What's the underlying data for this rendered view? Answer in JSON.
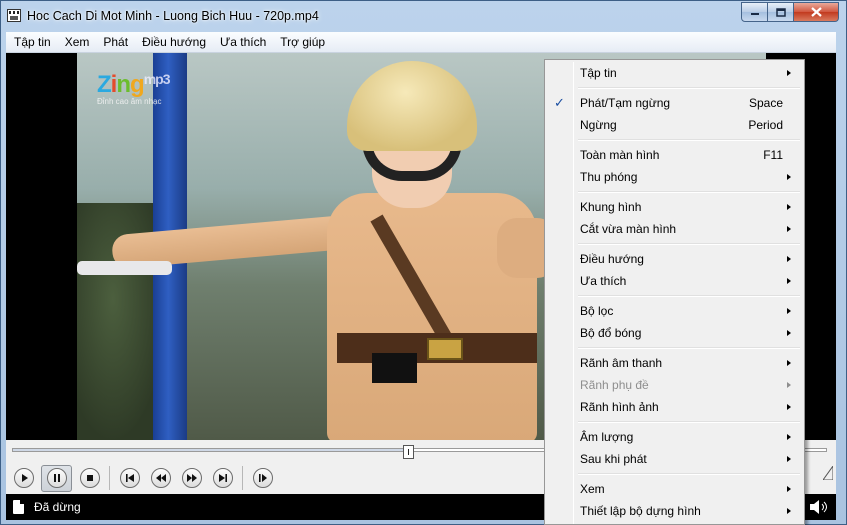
{
  "window": {
    "title": "Hoc Cach Di Mot Minh - Luong Bich Huu - 720p.mp4"
  },
  "menubar": {
    "items": [
      {
        "label": "Tập tin"
      },
      {
        "label": "Xem"
      },
      {
        "label": "Phát"
      },
      {
        "label": "Điều hướng"
      },
      {
        "label": "Ưa thích"
      },
      {
        "label": "Trợ giúp"
      }
    ]
  },
  "video": {
    "logo_main": "Zing",
    "logo_sub": "mp3",
    "logo_tagline": "Đỉnh cao âm nhạc"
  },
  "playback": {
    "position_fraction": 0.49
  },
  "status": {
    "text": "Đã dừng"
  },
  "context_menu": {
    "items": [
      {
        "label": "Tập tin",
        "submenu": true
      },
      {
        "separator": true
      },
      {
        "label": "Phát/Tạm ngừng",
        "shortcut": "Space",
        "checked": true
      },
      {
        "label": "Ngừng",
        "shortcut": "Period"
      },
      {
        "separator": true
      },
      {
        "label": "Toàn màn hình",
        "shortcut": "F11"
      },
      {
        "label": "Thu phóng",
        "submenu": true
      },
      {
        "separator": true
      },
      {
        "label": "Khung hình",
        "submenu": true
      },
      {
        "label": "Cắt vừa màn hình",
        "submenu": true
      },
      {
        "separator": true
      },
      {
        "label": "Điều hướng",
        "submenu": true
      },
      {
        "label": "Ưa thích",
        "submenu": true
      },
      {
        "separator": true
      },
      {
        "label": "Bộ lọc",
        "submenu": true
      },
      {
        "label": "Bộ đổ bóng",
        "submenu": true
      },
      {
        "separator": true
      },
      {
        "label": "Rãnh âm thanh",
        "submenu": true
      },
      {
        "label": "Rãnh phụ đề",
        "submenu": true,
        "disabled": true
      },
      {
        "label": "Rãnh hình ảnh",
        "submenu": true
      },
      {
        "separator": true
      },
      {
        "label": "Âm lượng",
        "submenu": true
      },
      {
        "label": "Sau khi phát",
        "submenu": true
      },
      {
        "separator": true
      },
      {
        "label": "Xem",
        "submenu": true
      },
      {
        "label": "Thiết lập bộ dựng hình",
        "submenu": true
      }
    ]
  },
  "colors": {
    "menu_check": "#1a4ea1",
    "statusbar_bg": "#000000"
  }
}
